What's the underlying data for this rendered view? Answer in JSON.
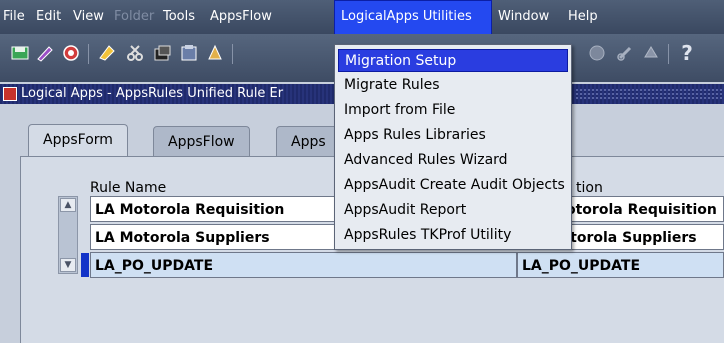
{
  "menubar": {
    "items": [
      {
        "label": "File",
        "state": "normal"
      },
      {
        "label": "Edit",
        "state": "normal"
      },
      {
        "label": "View",
        "state": "normal"
      },
      {
        "label": "Folder",
        "state": "disabled"
      },
      {
        "label": "Tools",
        "state": "normal"
      },
      {
        "label": "AppsFlow",
        "state": "normal"
      },
      {
        "label": "LogicalApps Utilities",
        "state": "active"
      },
      {
        "label": "Window",
        "state": "normal"
      },
      {
        "label": "Help",
        "state": "normal"
      }
    ]
  },
  "toolbar": {
    "icons": [
      "save-icon",
      "print-icon",
      "refresh-icon",
      "edit-icon",
      "cut-icon",
      "copy-icon",
      "paste-icon",
      "attach-icon",
      "globe-icon",
      "link-icon",
      "settings-icon",
      "help-icon"
    ],
    "help_glyph": "?"
  },
  "window": {
    "title": "Logical Apps - AppsRules Unified Rule Er"
  },
  "tabs": [
    {
      "label": "AppsForm",
      "active": true
    },
    {
      "label": "AppsFlow",
      "active": false
    },
    {
      "label": "Apps",
      "active": false
    }
  ],
  "table": {
    "columns": [
      "Rule Name",
      "tion"
    ],
    "rows": [
      {
        "name": "LA Motorola Requisition",
        "desc": "otorola Requisition"
      },
      {
        "name": "LA Motorola Suppliers",
        "desc": "LA Motorola Suppliers"
      },
      {
        "name": "LA_PO_UPDATE",
        "desc": "LA_PO_UPDATE",
        "selected": true
      }
    ]
  },
  "dropdown": {
    "items": [
      "Migration Setup",
      "Migrate Rules",
      "Import from File",
      "Apps Rules Libraries",
      "Advanced Rules Wizard",
      "AppsAudit Create Audit Objects",
      "AppsAudit Report",
      "AppsRules TKProf Utility"
    ],
    "highlighted_index": 0
  },
  "colors": {
    "menubar_bg": "#4f5f77",
    "highlight": "#2a3de0",
    "selected_row": "#cfe0f3",
    "window_title_bg": "#1f2a6b"
  }
}
